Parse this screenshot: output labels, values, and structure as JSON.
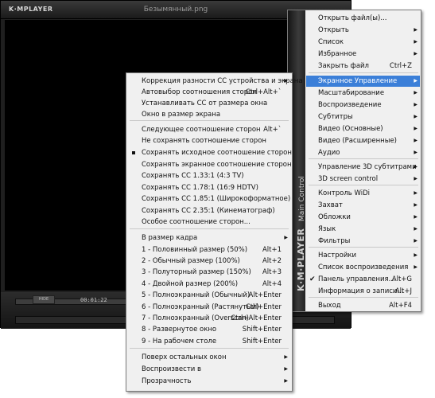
{
  "window": {
    "logo": "K·MPLAYER",
    "title": "Безымянный.png",
    "hint_button": "HIDE",
    "timecode": "00:01:22"
  },
  "main_menu": {
    "sidebar_logo": "K·M·PLAYER",
    "sidebar_caption": "Main Control",
    "items": [
      {
        "label": "Открыть файл(ы)...",
        "shortcut": "",
        "arrow": false
      },
      {
        "label": "Открыть",
        "shortcut": "",
        "arrow": true
      },
      {
        "label": "Список",
        "shortcut": "",
        "arrow": true
      },
      {
        "label": "Избранное",
        "shortcut": "",
        "arrow": true
      },
      {
        "label": "Закрыть файл",
        "shortcut": "Ctrl+Z",
        "arrow": false
      },
      {
        "label": "Экранное Управление",
        "shortcut": "",
        "arrow": true,
        "highlighted": true
      },
      {
        "label": "Масштабирование",
        "shortcut": "",
        "arrow": true
      },
      {
        "label": "Воспроизведение",
        "shortcut": "",
        "arrow": true
      },
      {
        "label": "Субтитры",
        "shortcut": "",
        "arrow": true
      },
      {
        "label": "Видео (Основные)",
        "shortcut": "",
        "arrow": true
      },
      {
        "label": "Видео (Расширенные)",
        "shortcut": "",
        "arrow": true
      },
      {
        "label": "Аудио",
        "shortcut": "",
        "arrow": true
      },
      {
        "label": "Управление 3D субтитрами",
        "shortcut": "",
        "arrow": true
      },
      {
        "label": "3D screen control",
        "shortcut": "",
        "arrow": true
      },
      {
        "label": "Контроль WiDi",
        "shortcut": "",
        "arrow": true
      },
      {
        "label": "Захват",
        "shortcut": "",
        "arrow": true
      },
      {
        "label": "Обложки",
        "shortcut": "",
        "arrow": true
      },
      {
        "label": "Язык",
        "shortcut": "",
        "arrow": true
      },
      {
        "label": "Фильтры",
        "shortcut": "",
        "arrow": true
      },
      {
        "label": "Настройки",
        "shortcut": "",
        "arrow": true
      },
      {
        "label": "Список воспроизведения",
        "shortcut": "",
        "arrow": true
      },
      {
        "label": "Панель управления...",
        "shortcut": "Alt+G",
        "arrow": false,
        "checked": true
      },
      {
        "label": "Информация о записи...",
        "shortcut": "Alt+J",
        "arrow": false
      },
      {
        "label": "Выход",
        "shortcut": "Alt+F4",
        "arrow": false
      }
    ]
  },
  "sub_menu": {
    "items": [
      {
        "label": "Коррекция разности СС устройства и экрана",
        "shortcut": "",
        "arrow": true
      },
      {
        "label": "Автовыбор соотношения сторон",
        "shortcut": "Ctrl+Alt+`",
        "arrow": false
      },
      {
        "label": "Устанавливать СС от размера окна",
        "shortcut": "",
        "arrow": false
      },
      {
        "label": "Окно в размер экрана",
        "shortcut": "",
        "arrow": false
      },
      {
        "label": "Следующее соотношение сторон",
        "shortcut": "Alt+`",
        "arrow": false
      },
      {
        "label": "Не сохранять соотношение сторон",
        "shortcut": "",
        "arrow": false
      },
      {
        "label": "Сохранять исходное соотношение сторон",
        "shortcut": "",
        "arrow": false,
        "selected": true
      },
      {
        "label": "Сохранять экранное соотношение сторон",
        "shortcut": "",
        "arrow": false
      },
      {
        "label": "Сохранять СС 1.33:1 (4:3 TV)",
        "shortcut": "",
        "arrow": false
      },
      {
        "label": "Сохранять СС 1.78:1 (16:9 HDTV)",
        "shortcut": "",
        "arrow": false
      },
      {
        "label": "Сохранять СС 1.85:1 (Широкоформатное)",
        "shortcut": "",
        "arrow": false
      },
      {
        "label": "Сохранять СС 2.35:1 (Кинематограф)",
        "shortcut": "",
        "arrow": false
      },
      {
        "label": "Особое соотношение сторон...",
        "shortcut": "",
        "arrow": false
      },
      {
        "label": "В размер кадра",
        "shortcut": "",
        "arrow": true
      },
      {
        "label": "1 - Половинный размер (50%)",
        "shortcut": "Alt+1",
        "arrow": false
      },
      {
        "label": "2 - Обычный размер (100%)",
        "shortcut": "Alt+2",
        "arrow": false
      },
      {
        "label": "3 - Полуторный размер (150%)",
        "shortcut": "Alt+3",
        "arrow": false
      },
      {
        "label": "4 - Двойной размер (200%)",
        "shortcut": "Alt+4",
        "arrow": false
      },
      {
        "label": "5 - Полноэкранный (Обычный)",
        "shortcut": "Alt+Enter",
        "arrow": false
      },
      {
        "label": "6 - Полноэкранный (Растянутый)",
        "shortcut": "Ctrl+Enter",
        "arrow": false
      },
      {
        "label": "7 - Полноэкранный (Overscan)",
        "shortcut": "Ctrl+Alt+Enter",
        "arrow": false
      },
      {
        "label": "8 - Развернутое окно",
        "shortcut": "Shift+Enter",
        "arrow": false
      },
      {
        "label": "9 - На рабочем столе",
        "shortcut": "Shift+Enter",
        "arrow": false
      },
      {
        "label": "Поверх остальных окон",
        "shortcut": "",
        "arrow": true
      },
      {
        "label": "Воспроизвести в",
        "shortcut": "",
        "arrow": true
      },
      {
        "label": "Прозрачность",
        "shortcut": "",
        "arrow": true
      }
    ]
  },
  "colors": {
    "highlight": "#3b7fd8",
    "menu_bg": "#f0f0f0",
    "player_bg": "#1f1f1f"
  }
}
